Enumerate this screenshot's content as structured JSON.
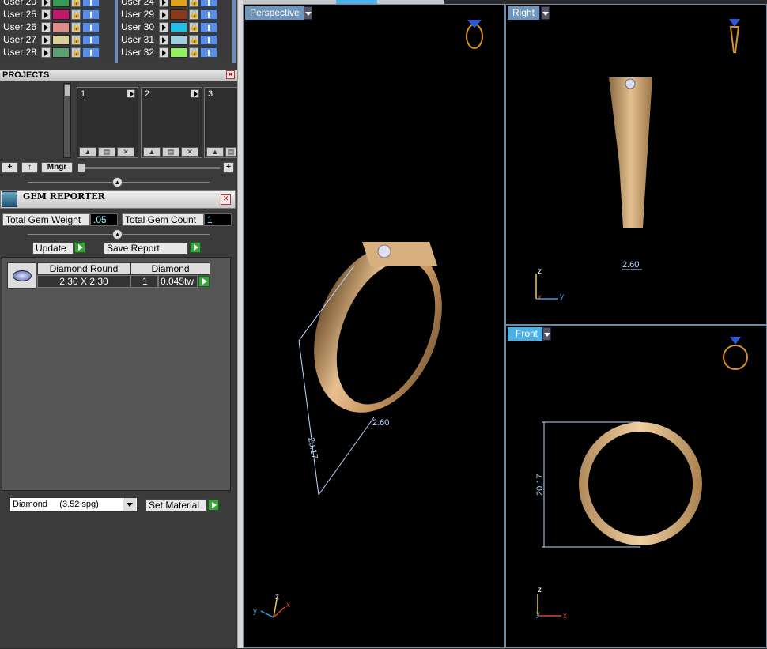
{
  "layers": {
    "left_col": [
      {
        "name": "User 20",
        "color": "#3a9a5a"
      },
      {
        "name": "User 25",
        "color": "#c0186a"
      },
      {
        "name": "User 26",
        "color": "#e08a8a"
      },
      {
        "name": "User 27",
        "color": "#d8cf9a"
      },
      {
        "name": "User 28",
        "color": "#5aa070"
      }
    ],
    "right_col": [
      {
        "name": "User 24",
        "color": "#e0a020"
      },
      {
        "name": "User 29",
        "color": "#8a3a1a"
      },
      {
        "name": "User 30",
        "color": "#20c0e8"
      },
      {
        "name": "User 31",
        "color": "#a0d0e0"
      },
      {
        "name": "User 32",
        "color": "#90f060"
      }
    ]
  },
  "projects": {
    "title": "PROJECTS",
    "slots": [
      "1",
      "2",
      "3"
    ],
    "mngr_label": "Mngr"
  },
  "gem_reporter": {
    "title": "GEM REPORTER",
    "weight_label": "Total Gem Weight",
    "weight_value": ".05",
    "count_label": "Total Gem Count",
    "count_value": "1",
    "update_label": "Update",
    "save_label": "Save Report",
    "table": {
      "headers": [
        "Diamond Round",
        "Diamond"
      ],
      "size": "2.30 X 2.30",
      "qty": "1",
      "weight": "0.045tw"
    },
    "material_select": "Diamond     (3.52 spg)",
    "set_material_label": "Set Material"
  },
  "viewports": {
    "perspective": {
      "label": "Perspective",
      "dim_a": "20.17",
      "dim_b": "2.60"
    },
    "right": {
      "label": "Right",
      "dim": "2.60"
    },
    "front": {
      "label": "Front",
      "dim": "20.17"
    }
  },
  "axes": {
    "x": "x",
    "y": "y",
    "z": "z"
  },
  "colors": {
    "gold": "#d8a86e",
    "dim_line": "#bcd8ff",
    "accent_blue": "#4ab0e6"
  }
}
